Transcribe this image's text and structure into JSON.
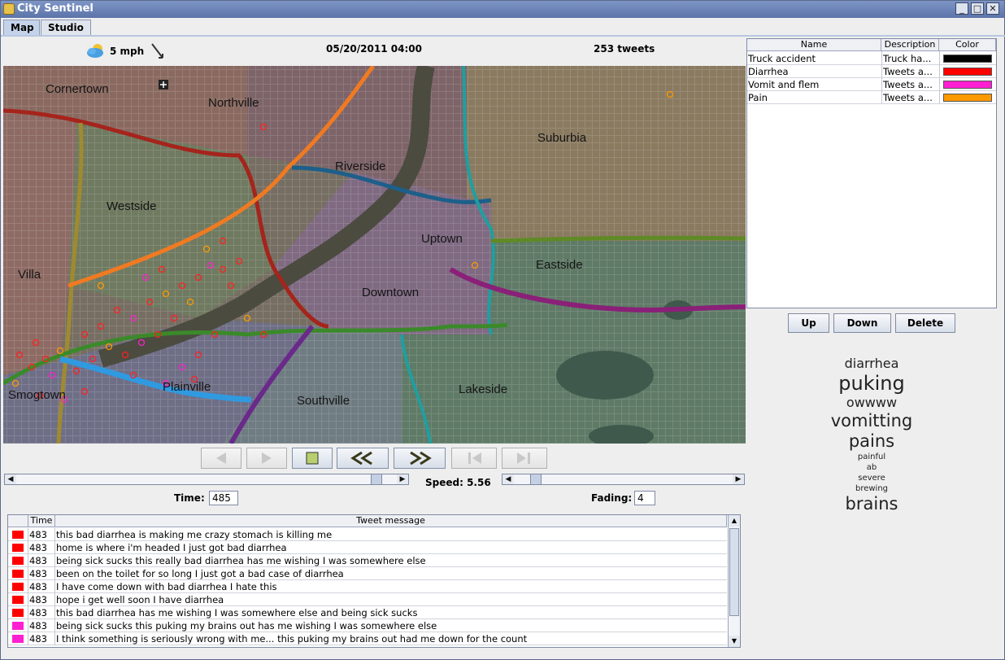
{
  "window": {
    "title": "City Sentinel",
    "controls": [
      "_",
      "□",
      "✕"
    ]
  },
  "tabs": [
    {
      "label": "Map",
      "active": true
    },
    {
      "label": "Studio",
      "active": false
    }
  ],
  "header": {
    "wind": "5 mph",
    "datetime": "05/20/2011 04:00",
    "tweet_count": "253 tweets",
    "weather_icon": "cloudy-sun-icon",
    "wind_icon": "wind-direction-icon"
  },
  "map": {
    "labels": [
      "Cornertown",
      "Northville",
      "Suburbia",
      "Riverside",
      "Westside",
      "Uptown",
      "Eastside",
      "Villa",
      "Downtown",
      "Plainville",
      "Smogtown",
      "Southville",
      "Lakeside"
    ]
  },
  "playback": {
    "buttons": [
      "step-back",
      "step-forward",
      "stop",
      "rewind",
      "fast-forward",
      "go-to-start",
      "go-to-end"
    ],
    "speed_text": "Speed: 5.56",
    "time_label": "Time:",
    "time_value": "485",
    "fading_label": "Fading:",
    "fading_value": "4"
  },
  "tweet_table": {
    "headers": [
      "",
      "Time",
      "Tweet message"
    ],
    "rows": [
      {
        "color": "#ff0000",
        "time": "483",
        "msg": "this bad diarrhea is making me crazy stomach is killing me"
      },
      {
        "color": "#ff0000",
        "time": "483",
        "msg": "home is where i'm headed I just got bad diarrhea"
      },
      {
        "color": "#ff0000",
        "time": "483",
        "msg": "being sick sucks this really bad diarrhea has me wishing I was somewhere else"
      },
      {
        "color": "#ff0000",
        "time": "483",
        "msg": "been on the toilet for so long I just got a bad case of diarrhea"
      },
      {
        "color": "#ff0000",
        "time": "483",
        "msg": "I have come down with bad diarrhea I hate this"
      },
      {
        "color": "#ff0000",
        "time": "483",
        "msg": "hope i get well soon I have diarrhea"
      },
      {
        "color": "#ff0000",
        "time": "483",
        "msg": "this bad diarrhea has me wishing I was somewhere else and being sick sucks"
      },
      {
        "color": "#ff1fd2",
        "time": "483",
        "msg": "being sick sucks this puking my brains out has me wishing I was somewhere else"
      },
      {
        "color": "#ff1fd2",
        "time": "483",
        "msg": "I think something is seriously wrong with me... this puking my brains out had me down for the count"
      }
    ]
  },
  "legend": {
    "headers": [
      "Name",
      "Description",
      "Color"
    ],
    "rows": [
      {
        "name": "Truck accident",
        "desc": "Truck ha...",
        "color": "#000000"
      },
      {
        "name": "Diarrhea",
        "desc": "Tweets a...",
        "color": "#ff0000"
      },
      {
        "name": "Vomit and flem",
        "desc": "Tweets a...",
        "color": "#ff1fd2"
      },
      {
        "name": "Pain",
        "desc": "Tweets a...",
        "color": "#ff9900"
      }
    ],
    "buttons": {
      "up": "Up",
      "down": "Down",
      "delete": "Delete"
    }
  },
  "word_cloud": [
    {
      "word": "diarrhea",
      "size": 16
    },
    {
      "word": "puking",
      "size": 24
    },
    {
      "word": "owwww",
      "size": 16
    },
    {
      "word": "vomitting",
      "size": 21
    },
    {
      "word": "pains",
      "size": 21
    },
    {
      "word": "painful",
      "size": 10
    },
    {
      "word": "ab",
      "size": 10
    },
    {
      "word": "severe",
      "size": 10
    },
    {
      "word": "brewing",
      "size": 10
    },
    {
      "word": "brains",
      "size": 21
    }
  ]
}
